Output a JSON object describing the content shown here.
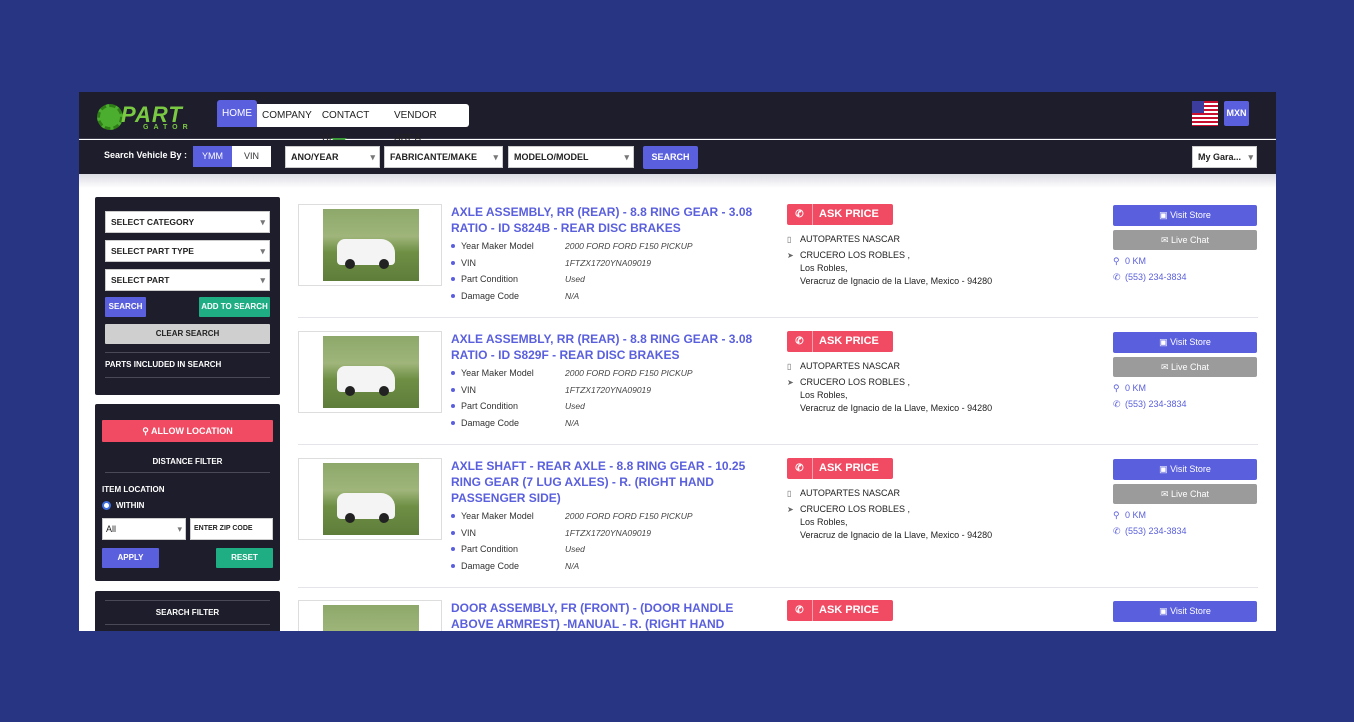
{
  "header": {
    "logo_main": "PART",
    "logo_sub": "GATOR",
    "nav": [
      "HOME",
      "COMPANY",
      "CONTACT US",
      "VENDOR AREA"
    ],
    "currency": "MXN"
  },
  "search": {
    "label": "Search Vehicle By :",
    "toggle_ymm": "YMM",
    "toggle_vin": "VIN",
    "year": "ANO/YEAR",
    "make": "FABRICANTE/MAKE",
    "model": "MODELO/MODEL",
    "button": "SEARCH",
    "garage": "My Gara..."
  },
  "sidebar": {
    "category": "SELECT CATEGORY",
    "part_type": "SELECT PART TYPE",
    "part": "SELECT PART",
    "search_btn": "SEARCH",
    "add_btn": "ADD TO SEARCH",
    "clear_btn": "CLEAR SEARCH",
    "included": "PARTS INCLUDED IN SEARCH",
    "allow_location": "ALLOW LOCATION",
    "distance_filter": "DISTANCE FILTER",
    "item_location": "ITEM LOCATION",
    "within": "WITHIN",
    "all": "All",
    "zip_placeholder": "ENTER ZIP CODE",
    "apply": "APPLY",
    "reset": "RESET",
    "search_filter": "SEARCH FILTER"
  },
  "labels": {
    "year_maker_model": "Year Maker Model",
    "vin": "VIN",
    "part_condition": "Part Condition",
    "damage_code": "Damage Code",
    "ask_price": "ASK PRICE",
    "visit_store": "Visit Store",
    "live_chat": "Live Chat"
  },
  "listings": [
    {
      "title": "AXLE ASSEMBLY, RR (REAR) - 8.8 RING GEAR - 3.08 RATIO - ID S824B - REAR DISC BRAKES",
      "ymm": "2000 FORD FORD F150 PICKUP",
      "vin": "1FTZX1720YNA09019",
      "condition": "Used",
      "damage": "N/A",
      "seller": "AUTOPARTES NASCAR",
      "addr1": "CRUCERO LOS ROBLES ,",
      "addr2": "Los Robles,",
      "addr3": "Veracruz de Ignacio de la Llave, Mexico - 94280",
      "distance": "0 KM",
      "phone": "(553) 234-3834"
    },
    {
      "title": "AXLE ASSEMBLY, RR (REAR) - 8.8 RING GEAR - 3.08 RATIO - ID S829F - REAR DISC BRAKES",
      "ymm": "2000 FORD FORD F150 PICKUP",
      "vin": "1FTZX1720YNA09019",
      "condition": "Used",
      "damage": "N/A",
      "seller": "AUTOPARTES NASCAR",
      "addr1": "CRUCERO LOS ROBLES ,",
      "addr2": "Los Robles,",
      "addr3": "Veracruz de Ignacio de la Llave, Mexico - 94280",
      "distance": "0 KM",
      "phone": "(553) 234-3834"
    },
    {
      "title": "AXLE SHAFT - REAR AXLE - 8.8 RING GEAR - 10.25 RING GEAR (7 LUG AXLES) - R. (RIGHT HAND PASSENGER SIDE)",
      "ymm": "2000 FORD FORD F150 PICKUP",
      "vin": "1FTZX1720YNA09019",
      "condition": "Used",
      "damage": "N/A",
      "seller": "AUTOPARTES NASCAR",
      "addr1": "CRUCERO LOS ROBLES ,",
      "addr2": "Los Robles,",
      "addr3": "Veracruz de Ignacio de la Llave, Mexico - 94280",
      "distance": "0 KM",
      "phone": "(553) 234-3834"
    },
    {
      "title": "DOOR ASSEMBLY, FR (FRONT) - (DOOR HANDLE ABOVE ARMREST) -MANUAL - R. (RIGHT HAND PASSENGER"
    }
  ]
}
